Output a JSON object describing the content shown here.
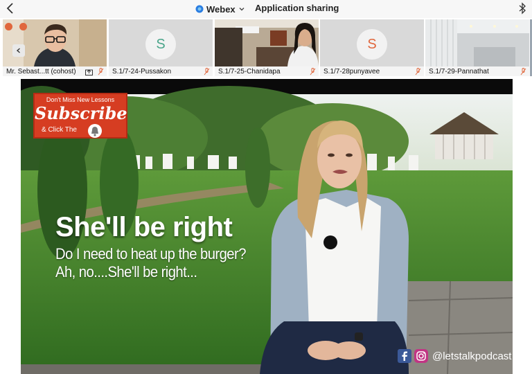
{
  "topbar": {
    "app_name": "Webex",
    "title": "Application sharing",
    "colors": {
      "webex_blue": "#2a7de1"
    }
  },
  "participants": [
    {
      "name": "Mr. Sebast...tt (cohost)",
      "initial": ""
    },
    {
      "name": "S.1/7-24-Pussakon",
      "initial": "S",
      "initial_color": "#4aa58a"
    },
    {
      "name": "S.1/7-25-Chanidapa",
      "initial": ""
    },
    {
      "name": "S.1/7-28punyavee",
      "initial": "S",
      "initial_color": "#e0673d"
    },
    {
      "name": "S.1/7-29-Pannathat",
      "initial": ""
    }
  ],
  "video": {
    "subscribe_top": "Don't Miss New Lessons",
    "subscribe_main": "Subscribe",
    "subscribe_bottom": "& Click The",
    "headline": "She'll be right",
    "caption_line1": "Do I need to heat up the burger?",
    "caption_line2": "Ah, no....She'll be right...",
    "social_handle": "@letstalkpodcast"
  }
}
